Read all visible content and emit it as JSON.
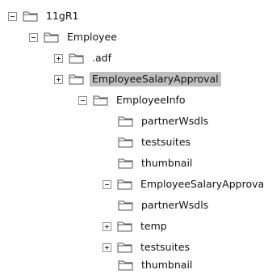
{
  "tree": [
    {
      "label": "11gR1",
      "toggle": "minus"
    },
    {
      "label": "Employee",
      "toggle": "minus"
    },
    {
      "label": ".adf",
      "toggle": "plus"
    },
    {
      "label": "EmployeeSalaryApproval",
      "toggle": "plus",
      "selected": true
    },
    {
      "label": "EmployeeInfo",
      "toggle": "minus"
    },
    {
      "label": "partnerWsdls",
      "toggle": "none"
    },
    {
      "label": "testsuites",
      "toggle": "none"
    },
    {
      "label": "thumbnail",
      "toggle": "none"
    },
    {
      "label": "EmployeeSalaryApprova",
      "toggle": "minus"
    },
    {
      "label": "partnerWsdls",
      "toggle": "none"
    },
    {
      "label": "temp",
      "toggle": "plus"
    },
    {
      "label": "testsuites",
      "toggle": "plus"
    },
    {
      "label": "thumbnail",
      "toggle": "none"
    }
  ],
  "icons": {
    "toggle_minus": "collapse-icon",
    "toggle_plus": "expand-icon",
    "folder": "folder-icon"
  }
}
